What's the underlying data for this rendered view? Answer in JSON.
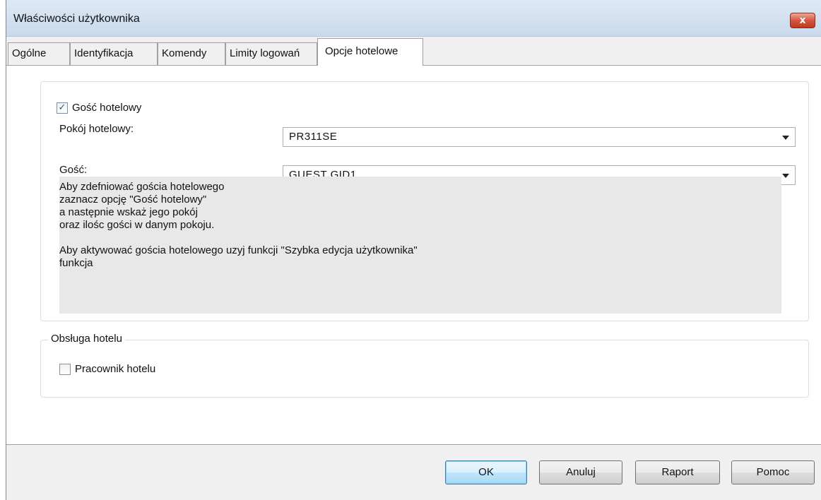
{
  "window": {
    "title": "Właściwości użytkownika",
    "close_glyph": "x"
  },
  "tabs": [
    {
      "label": "Ogólne"
    },
    {
      "label": "Identyfikacja"
    },
    {
      "label": "Komendy"
    },
    {
      "label": "Limity logowań"
    },
    {
      "label": "Opcje hotelowe",
      "active": true
    }
  ],
  "guest_section": {
    "guest_checkbox": {
      "label": "Gość hotelowy",
      "checked": true
    },
    "room_label": "Pokój hotelowy:",
    "room_value": "PR311SE",
    "guest_label": "Gość:",
    "guest_value": "GUEST GID1",
    "info_lines": [
      "Aby zdefniować gościa hotelowego",
      "zaznacz opcję \"Gość hotelowy\"",
      "a następnie wskaż jego pokój",
      "oraz ilośc gości w danym pokoju."
    ],
    "info_lines2": [
      "Aby aktywować gościa hotelowego uzyj funkcji \"Szybka edycja użytkownika\"",
      "funkcja"
    ]
  },
  "hotel_service": {
    "legend": "Obsługa hotelu",
    "staff_checkbox": {
      "label": "Pracownik hotelu",
      "checked": false
    }
  },
  "buttons": {
    "ok": "OK",
    "cancel": "Anuluj",
    "report": "Raport",
    "help": "Pomoc"
  }
}
